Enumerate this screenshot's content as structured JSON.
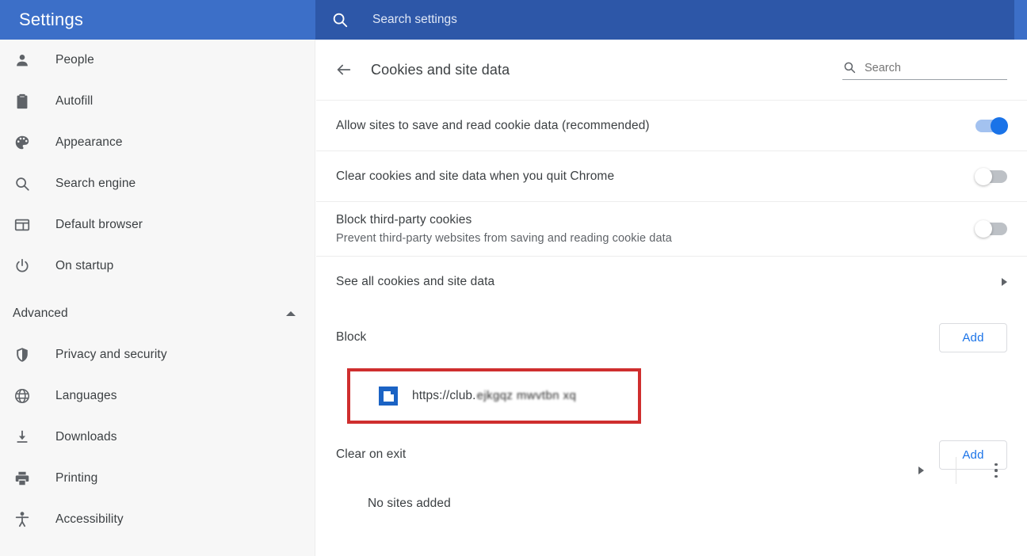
{
  "header": {
    "title": "Settings",
    "search_placeholder": "Search settings",
    "search_value": "",
    "search_icon": "search-icon",
    "bg_color": "#3c6fc8",
    "search_bg_color": "#2d57a8"
  },
  "sidebar": {
    "items": [
      {
        "label": "People",
        "icon": "person-icon"
      },
      {
        "label": "Autofill",
        "icon": "clipboard-icon"
      },
      {
        "label": "Appearance",
        "icon": "palette-icon"
      },
      {
        "label": "Search engine",
        "icon": "search-icon"
      },
      {
        "label": "Default browser",
        "icon": "browser-window-icon"
      },
      {
        "label": "On startup",
        "icon": "power-icon"
      }
    ],
    "advanced": {
      "label": "Advanced",
      "expanded": true,
      "icon": "caret-up-icon",
      "items": [
        {
          "label": "Privacy and security",
          "icon": "shield-icon"
        },
        {
          "label": "Languages",
          "icon": "globe-icon"
        },
        {
          "label": "Downloads",
          "icon": "download-icon"
        },
        {
          "label": "Printing",
          "icon": "printer-icon"
        },
        {
          "label": "Accessibility",
          "icon": "accessibility-icon"
        }
      ]
    }
  },
  "main": {
    "back_icon": "arrow-left-icon",
    "page_title": "Cookies and site data",
    "search": {
      "placeholder": "Search",
      "value": "",
      "icon": "search-icon"
    },
    "settings_rows": [
      {
        "title": "Allow sites to save and read cookie data (recommended)",
        "subtitle": "",
        "control": "toggle",
        "state": "on"
      },
      {
        "title": "Clear cookies and site data when you quit Chrome",
        "subtitle": "",
        "control": "toggle",
        "state": "off"
      },
      {
        "title": "Block third-party cookies",
        "subtitle": "Prevent third-party websites from saving and reading cookie data",
        "control": "toggle",
        "state": "off"
      },
      {
        "title": "See all cookies and site data",
        "subtitle": "",
        "control": "caret-right",
        "state": ""
      }
    ],
    "block_section": {
      "title": "Block",
      "add_label": "Add",
      "sites": [
        {
          "url_visible": "https://club.",
          "url_redacted": "ejkgqz mwvtbn xq",
          "favicon": "blue-window-favicon",
          "expand_icon": "caret-right-icon",
          "menu_icon": "more-vertical-icon",
          "highlighted": true,
          "highlight_color": "#cf2e2e"
        }
      ]
    },
    "clear_on_exit_section": {
      "title": "Clear on exit",
      "add_label": "Add",
      "empty_text": "No sites added"
    }
  },
  "colors": {
    "accent_blue": "#1a73e8",
    "header_blue": "#3c6fc8",
    "text_primary": "#3c4043",
    "text_secondary": "#5f6368",
    "highlight_red": "#cf2e2e"
  }
}
